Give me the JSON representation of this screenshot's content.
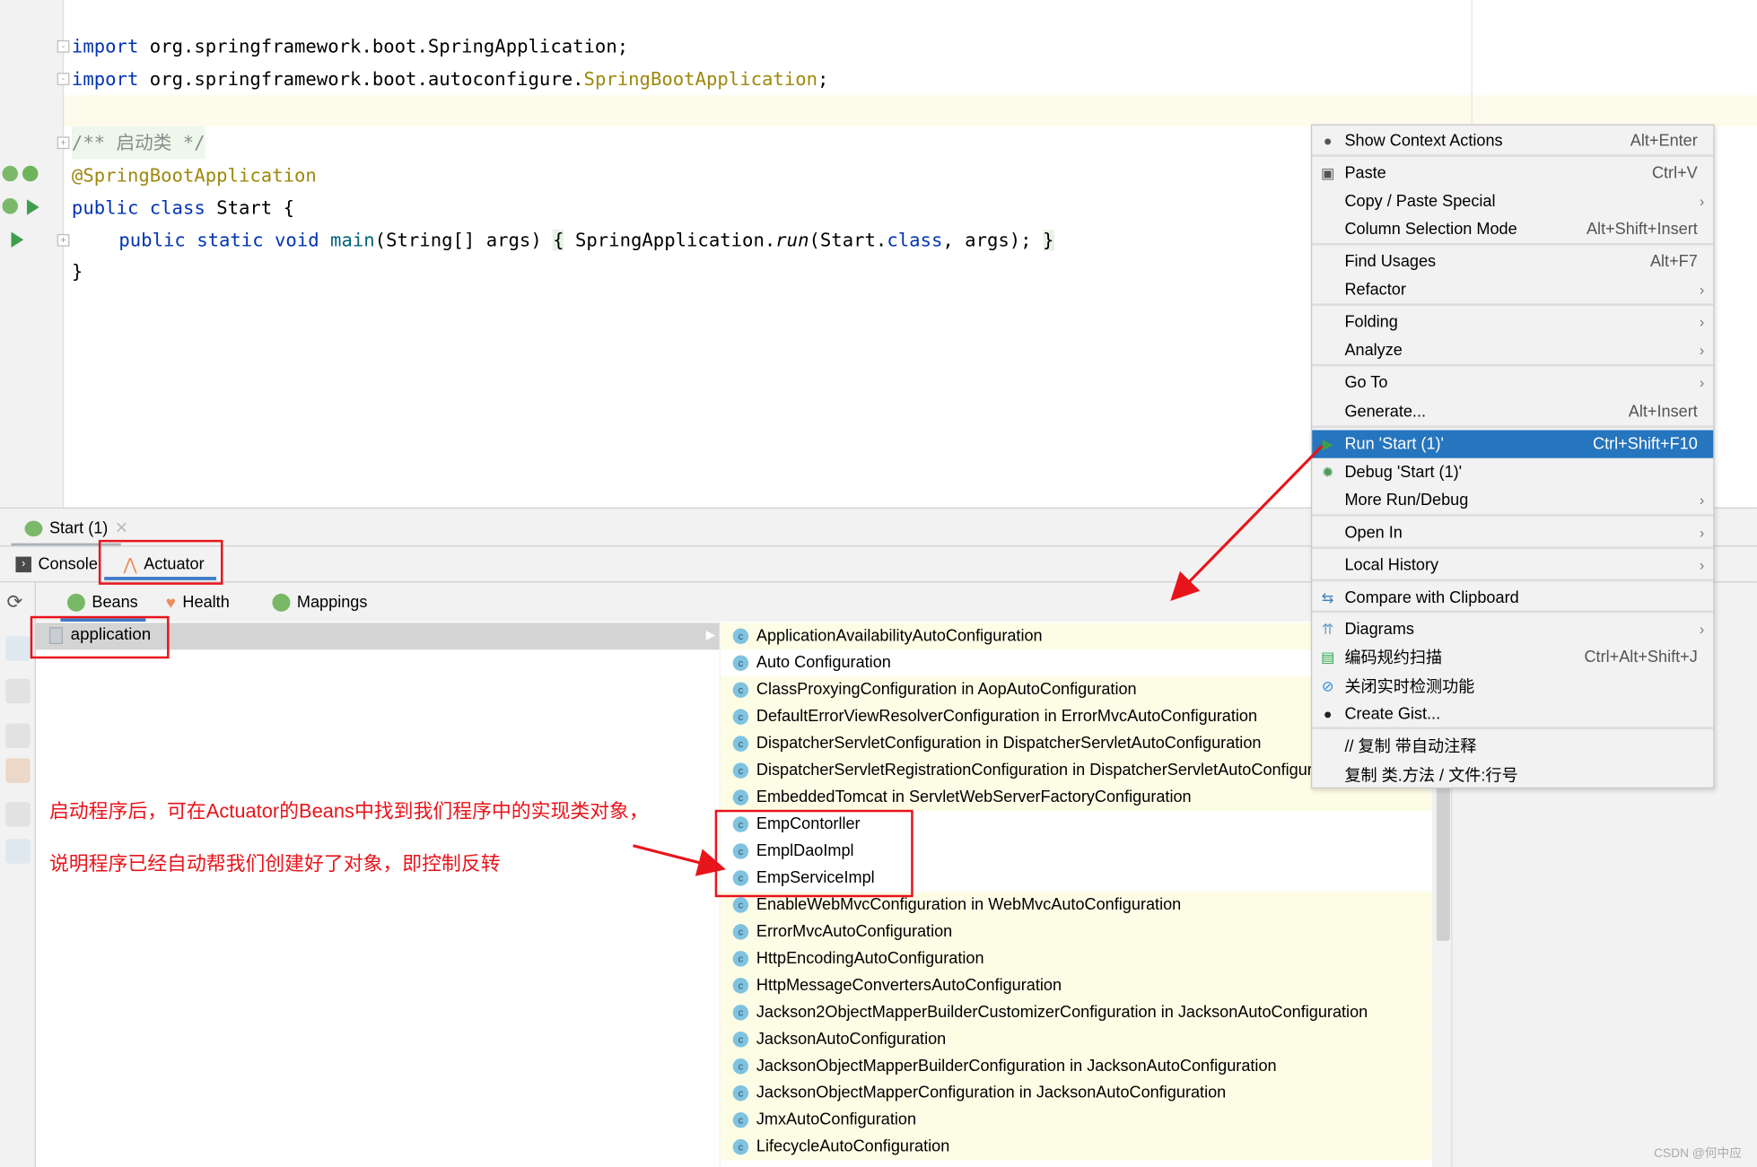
{
  "editor": {
    "lines": [
      {
        "kw": "import",
        "rest": " org.springframework.boot.SpringApplication;"
      },
      {
        "kw": "import",
        "rest": " org.springframework.boot.autoconfigure.",
        "ann": "SpringBootApplication",
        "end": ";"
      }
    ],
    "comment": "/** 启动类 */",
    "annotation": "@SpringBootApplication",
    "class_kw": "public class",
    "class_name": " Start {",
    "main_kw": "public static void",
    "main_fn": " main",
    "main_args": "(String[] args) ",
    "main_open": "{",
    "main_body": " SpringApplication.",
    "main_run": "run",
    "main_arg1": "(Start.",
    "main_class": "class",
    "main_end": ", args); ",
    "main_close": "}",
    "close": "}"
  },
  "toolwindow": {
    "run_tab": "Start (1)",
    "tabs": [
      "Console",
      "Actuator"
    ],
    "subtabs": [
      "Beans",
      "Health",
      "Mappings"
    ],
    "app_node": "application",
    "beans": [
      "ApplicationAvailabilityAutoConfiguration",
      "Auto Configuration",
      "ClassProxyingConfiguration in AopAutoConfiguration",
      "DefaultErrorViewResolverConfiguration in ErrorMvcAutoConfiguration",
      "DispatcherServletConfiguration in DispatcherServletAutoConfiguration",
      "DispatcherServletRegistrationConfiguration in DispatcherServletAutoConfiguration",
      "EmbeddedTomcat in ServletWebServerFactoryConfiguration",
      "EmpContorller",
      "EmplDaoImpl",
      "EmpServiceImpl",
      "EnableWebMvcConfiguration in WebMvcAutoConfiguration",
      "ErrorMvcAutoConfiguration",
      "HttpEncodingAutoConfiguration",
      "HttpMessageConvertersAutoConfiguration",
      "Jackson2ObjectMapperBuilderCustomizerConfiguration in JacksonAutoConfiguration",
      "JacksonAutoConfiguration",
      "JacksonObjectMapperBuilderConfiguration in JacksonAutoConfiguration",
      "JacksonObjectMapperConfiguration in JacksonAutoConfiguration",
      "JmxAutoConfiguration",
      "LifecycleAutoConfiguration"
    ]
  },
  "menu": {
    "items": [
      {
        "label": "Show Context Actions",
        "shortcut": "Alt+Enter",
        "icon": "bulb-icon"
      },
      {
        "label": "Paste",
        "shortcut": "Ctrl+V",
        "icon": "clipboard-icon"
      },
      {
        "label": "Copy / Paste Special",
        "submenu": true
      },
      {
        "label": "Column Selection Mode",
        "shortcut": "Alt+Shift+Insert"
      },
      {
        "label": "Find Usages",
        "shortcut": "Alt+F7"
      },
      {
        "label": "Refactor",
        "submenu": true
      },
      {
        "label": "Folding",
        "submenu": true
      },
      {
        "label": "Analyze",
        "submenu": true
      },
      {
        "label": "Go To",
        "submenu": true
      },
      {
        "label": "Generate...",
        "shortcut": "Alt+Insert"
      },
      {
        "label": "Run 'Start (1)'",
        "shortcut": "Ctrl+Shift+F10",
        "icon": "run-icon",
        "selected": true
      },
      {
        "label": "Debug 'Start (1)'",
        "icon": "debug-icon"
      },
      {
        "label": "More Run/Debug",
        "submenu": true
      },
      {
        "label": "Open In",
        "submenu": true
      },
      {
        "label": "Local History",
        "submenu": true
      },
      {
        "label": "Compare with Clipboard",
        "icon": "compare-icon"
      },
      {
        "label": "Diagrams",
        "submenu": true,
        "icon": "diagram-icon"
      },
      {
        "label": "编码规约扫描",
        "shortcut": "Ctrl+Alt+Shift+J",
        "icon": "scan-icon"
      },
      {
        "label": "关闭实时检测功能",
        "icon": "forbid-icon"
      },
      {
        "label": "Create Gist...",
        "icon": "github-icon"
      },
      {
        "label": "// 复制 带自动注释"
      },
      {
        "label": "复制 类.方法 / 文件:行号"
      }
    ],
    "selected_color": "#2675bf"
  },
  "notes": [
    "启动程序后，可在Actuator的Beans中找到我们程序中的实现类对象，",
    "说明程序已经自动帮我们创建好了对象，即控制反转"
  ],
  "watermark": "CSDN @何中应",
  "annotation_color": "#e8141b"
}
